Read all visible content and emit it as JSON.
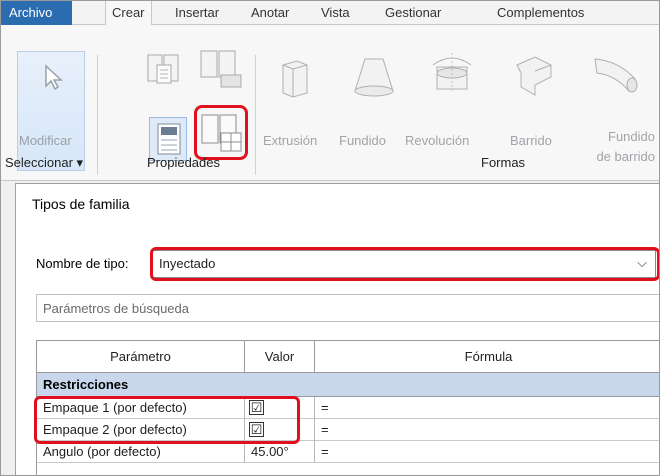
{
  "ribbon": {
    "tabs": [
      "Archivo",
      "Crear",
      "Insertar",
      "Anotar",
      "Vista",
      "Gestionar",
      "Complementos"
    ],
    "active_tab": "Crear",
    "modify_label": "Modificar",
    "groups": {
      "select": "Seleccionar ▾",
      "properties": "Propiedades",
      "forms": "Formas"
    },
    "forms": {
      "extrusion": "Extrusión",
      "blend": "Fundido",
      "revolve": "Revolución",
      "sweep": "Barrido",
      "swept_blend_1": "Fundido",
      "swept_blend_2": "de barrido"
    }
  },
  "dialog": {
    "title": "Tipos de familia",
    "type_name_label": "Nombre de tipo:",
    "type_name_value": "Inyectado",
    "search_placeholder": "Parámetros de búsqueda",
    "table": {
      "headers": [
        "Parámetro",
        "Valor",
        "Fórmula"
      ],
      "group": "Restricciones",
      "rows": [
        {
          "param": "Empaque 1 (por defecto)",
          "value": "☑",
          "formula": "="
        },
        {
          "param": "Empaque 2 (por defecto)",
          "value": "☑",
          "formula": "="
        },
        {
          "param": "Angulo (por defecto)",
          "value": "45.00°",
          "formula": "="
        }
      ]
    }
  },
  "colors": {
    "file_tab": "#2b6bb0",
    "highlight": "#e0101e",
    "group_row": "#c8d7ec"
  }
}
